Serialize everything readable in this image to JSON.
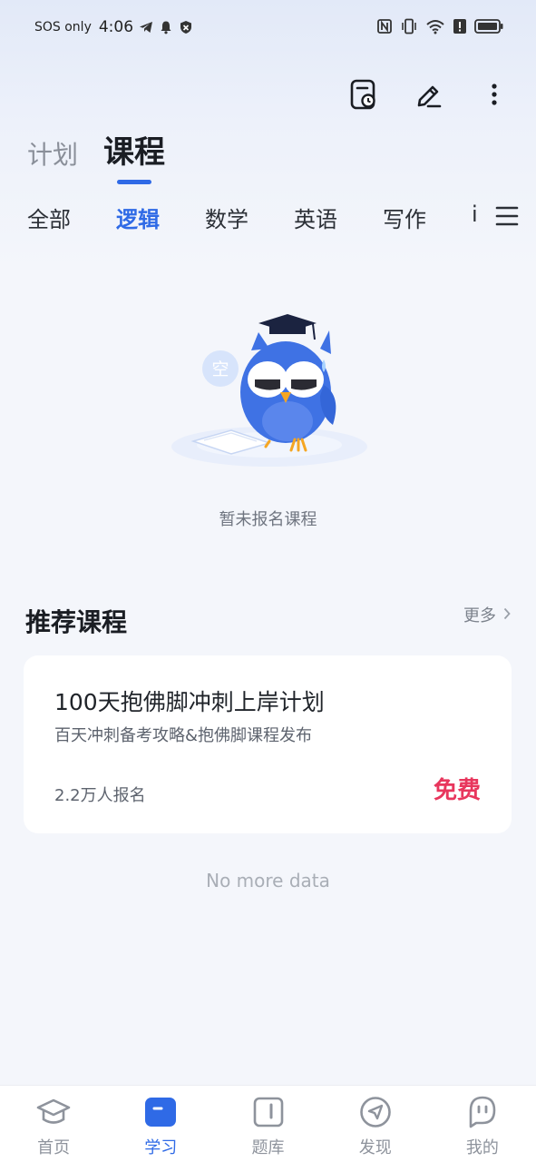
{
  "status_bar": {
    "carrier": "SOS only",
    "time": "4:06",
    "icons": [
      "telegram-icon",
      "bell-icon",
      "shield-icon",
      "nfc-icon",
      "vibrate-icon",
      "wifi-icon",
      "alert-icon",
      "battery-icon"
    ]
  },
  "toolbar": {
    "icons": [
      "schedule-icon",
      "edit-icon",
      "more-icon"
    ]
  },
  "main_tabs": [
    {
      "label": "计划",
      "active": false
    },
    {
      "label": "课程",
      "active": true
    }
  ],
  "subject_tabs": [
    {
      "label": "全部",
      "active": false
    },
    {
      "label": "逻辑",
      "active": true
    },
    {
      "label": "数学",
      "active": false
    },
    {
      "label": "英语",
      "active": false
    },
    {
      "label": "写作",
      "active": false
    },
    {
      "label": "i",
      "active": false
    }
  ],
  "empty_state": {
    "bubble_text": "空",
    "text": "暂未报名课程"
  },
  "recommended": {
    "title": "推荐课程",
    "more_label": "更多",
    "courses": [
      {
        "title": "100天抱佛脚冲刺上岸计划",
        "subtitle": "百天冲刺备考攻略&抱佛脚课程发布",
        "enrolled": "2.2万人报名",
        "price": "免费"
      }
    ]
  },
  "footer_text": "No more data",
  "bottom_nav": [
    {
      "label": "首页",
      "icon": "graduation-cap-icon",
      "active": false
    },
    {
      "label": "学习",
      "icon": "study-icon",
      "active": true
    },
    {
      "label": "题库",
      "icon": "question-bank-icon",
      "active": false
    },
    {
      "label": "发现",
      "icon": "discover-icon",
      "active": false
    },
    {
      "label": "我的",
      "icon": "profile-icon",
      "active": false
    }
  ],
  "colors": {
    "accent": "#2f6ae6",
    "price": "#e8365d",
    "background": "#f4f6fb"
  }
}
